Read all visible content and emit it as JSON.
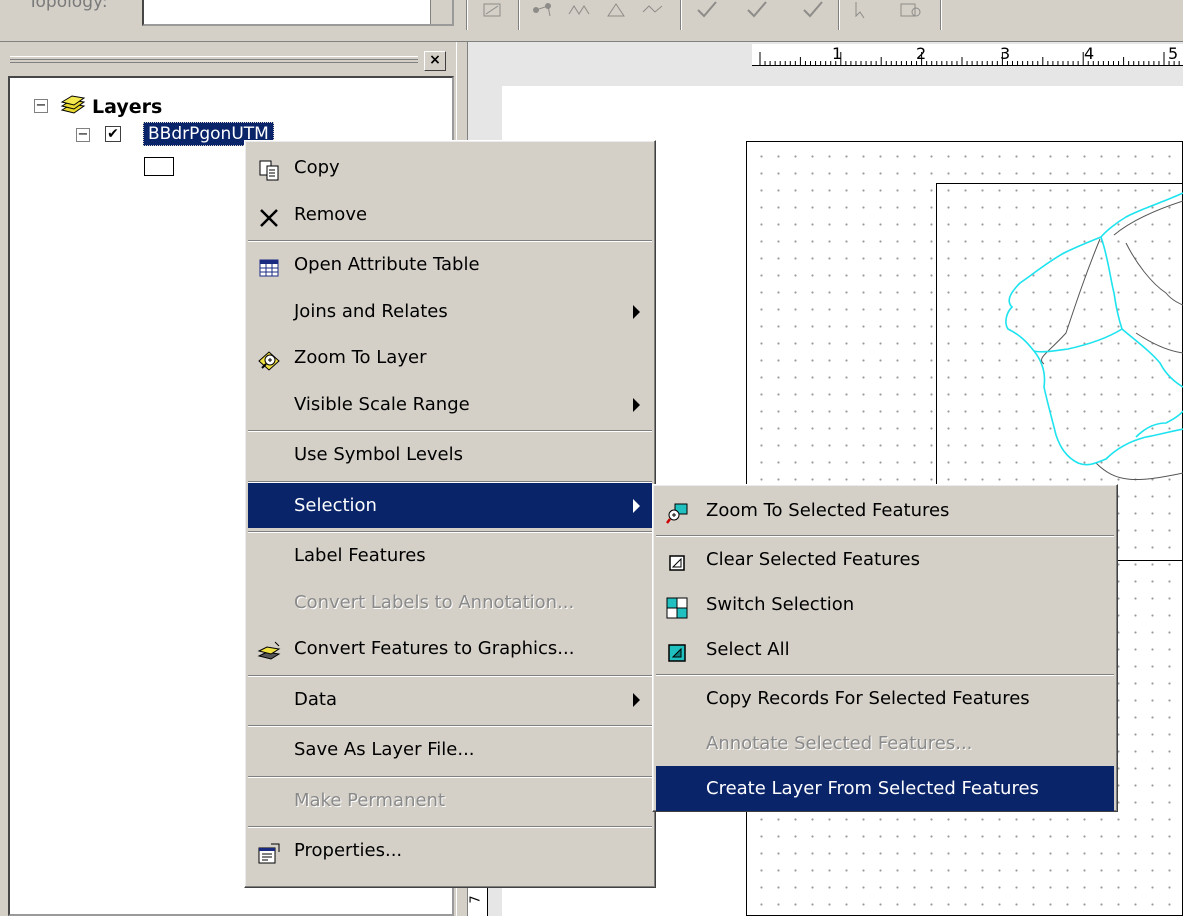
{
  "toolbar": {
    "label": "Topology:"
  },
  "toc": {
    "close_label": "×",
    "root_label": "Layers",
    "layer_label": "BBdrPgonUTM",
    "expander_symbol": "−",
    "check_symbol": "✔"
  },
  "ruler": {
    "labels": [
      "1",
      "2",
      "3",
      "4",
      "5"
    ],
    "vertical_label": "7"
  },
  "context_menu": {
    "items": [
      {
        "label": "Copy",
        "icon": "copy-icon"
      },
      {
        "label": "Remove",
        "icon": "remove-icon"
      },
      {
        "label": "Open Attribute Table",
        "icon": "table-icon"
      },
      {
        "label": "Joins and Relates",
        "submenu": true
      },
      {
        "label": "Zoom To Layer",
        "icon": "zoom-to-layer-icon"
      },
      {
        "label": "Visible Scale Range",
        "submenu": true
      },
      {
        "label": "Use Symbol Levels"
      },
      {
        "label": "Selection",
        "submenu": true,
        "highlighted": true
      },
      {
        "label": "Label Features"
      },
      {
        "label": "Convert Labels to Annotation...",
        "disabled": true
      },
      {
        "label": "Convert Features to Graphics...",
        "icon": "convert-graphics-icon"
      },
      {
        "label": "Data",
        "submenu": true
      },
      {
        "label": "Save As Layer File..."
      },
      {
        "label": "Make Permanent",
        "disabled": true
      },
      {
        "label": "Properties...",
        "icon": "properties-icon"
      }
    ]
  },
  "selection_submenu": {
    "items": [
      {
        "label": "Zoom To Selected Features",
        "icon": "zoom-selected-icon"
      },
      {
        "label": "Clear Selected Features",
        "icon": "clear-selection-icon"
      },
      {
        "label": "Switch Selection",
        "icon": "switch-selection-icon"
      },
      {
        "label": "Select All",
        "icon": "select-all-icon"
      },
      {
        "label": "Copy Records For Selected Features"
      },
      {
        "label": "Annotate Selected Features...",
        "disabled": true
      },
      {
        "label": "Create Layer From Selected Features",
        "highlighted": true
      }
    ]
  },
  "colors": {
    "highlight": "#0a246a",
    "menu_bg": "#d4d0c8",
    "selected_feature": "#00d8e8"
  }
}
